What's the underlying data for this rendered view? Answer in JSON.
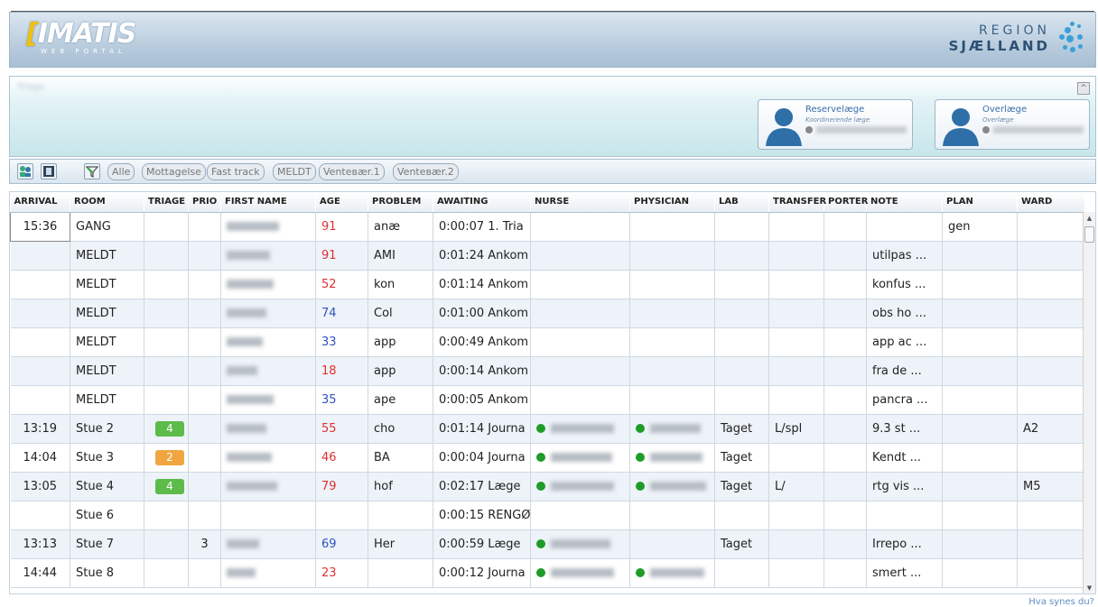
{
  "header": {
    "logo_main": "IMATIS",
    "logo_sub": "WEB PORTAL",
    "region_line1": "REGION",
    "region_line2": "SJÆLLAND"
  },
  "panel": {
    "title": "Triage",
    "cards": [
      {
        "role": "Reservelæge",
        "sub": "Koordinerende læge"
      },
      {
        "role": "Overlæge",
        "sub": "Overlæge"
      }
    ]
  },
  "toolbar": {
    "filters": [
      "Alle",
      "Mottagelse",
      "Fast track",
      "MELDT",
      "Venteвær.1",
      "Venteвær.2"
    ]
  },
  "table": {
    "columns": [
      "ARRIVAL",
      "ROOM",
      "TRIAGE",
      "PRIO",
      "FIRST NAME",
      "AGE",
      "PROBLEM",
      "AWAITING",
      "NURSE",
      "PHYSICIAN",
      "LAB",
      "TRANSFER",
      "PORTER",
      "NOTE",
      "PLAN",
      "WARD"
    ],
    "rows": [
      {
        "arrival": "15:36",
        "room": "GANG",
        "triage": "",
        "triage_color": "",
        "prio": "",
        "age": "91",
        "age_color": "red",
        "problem": "anæ",
        "awaiting": "0:00:07 1. Tria",
        "nurse": false,
        "physician": false,
        "lab": "",
        "transfer": "",
        "porter": "",
        "note": "",
        "plan": "gen",
        "ward": ""
      },
      {
        "arrival": "",
        "room": "MELDT",
        "triage": "",
        "triage_color": "",
        "prio": "",
        "age": "91",
        "age_color": "red",
        "problem": "AMI",
        "awaiting": "0:01:24 Ankom",
        "nurse": false,
        "physician": false,
        "lab": "",
        "transfer": "",
        "porter": "",
        "note": "utilpas ...",
        "plan": "",
        "ward": ""
      },
      {
        "arrival": "",
        "room": "MELDT",
        "triage": "",
        "triage_color": "",
        "prio": "",
        "age": "52",
        "age_color": "red",
        "problem": "kon",
        "awaiting": "0:01:14 Ankom",
        "nurse": false,
        "physician": false,
        "lab": "",
        "transfer": "",
        "porter": "",
        "note": "konfus ...",
        "plan": "",
        "ward": ""
      },
      {
        "arrival": "",
        "room": "MELDT",
        "triage": "",
        "triage_color": "",
        "prio": "",
        "age": "74",
        "age_color": "blue",
        "problem": "Col",
        "awaiting": "0:01:00 Ankom",
        "nurse": false,
        "physician": false,
        "lab": "",
        "transfer": "",
        "porter": "",
        "note": "obs ho ...",
        "plan": "",
        "ward": ""
      },
      {
        "arrival": "",
        "room": "MELDT",
        "triage": "",
        "triage_color": "",
        "prio": "",
        "age": "33",
        "age_color": "blue",
        "problem": "app",
        "awaiting": "0:00:49 Ankom",
        "nurse": false,
        "physician": false,
        "lab": "",
        "transfer": "",
        "porter": "",
        "note": "app ac ...",
        "plan": "",
        "ward": ""
      },
      {
        "arrival": "",
        "room": "MELDT",
        "triage": "",
        "triage_color": "",
        "prio": "",
        "age": "18",
        "age_color": "red",
        "problem": "app",
        "awaiting": "0:00:14 Ankom",
        "nurse": false,
        "physician": false,
        "lab": "",
        "transfer": "",
        "porter": "",
        "note": "fra de ...",
        "plan": "",
        "ward": ""
      },
      {
        "arrival": "",
        "room": "MELDT",
        "triage": "",
        "triage_color": "",
        "prio": "",
        "age": "35",
        "age_color": "blue",
        "problem": "ape",
        "awaiting": "0:00:05 Ankom",
        "nurse": false,
        "physician": false,
        "lab": "",
        "transfer": "",
        "porter": "",
        "note": "pancra ...",
        "plan": "",
        "ward": ""
      },
      {
        "arrival": "13:19",
        "room": "Stue 2",
        "triage": "4",
        "triage_color": "green",
        "prio": "",
        "age": "55",
        "age_color": "red",
        "problem": "cho",
        "awaiting": "0:01:14 Journa",
        "nurse": true,
        "physician": true,
        "lab": "Taget",
        "transfer": "L/spl",
        "porter": "",
        "note": "9.3 st ...",
        "plan": "",
        "ward": "A2"
      },
      {
        "arrival": "14:04",
        "room": "Stue 3",
        "triage": "2",
        "triage_color": "orange",
        "prio": "",
        "age": "46",
        "age_color": "red",
        "problem": "BA",
        "awaiting": "0:00:04 Journa",
        "nurse": true,
        "physician": true,
        "lab": "Taget",
        "transfer": "",
        "porter": "",
        "note": "Kendt ...",
        "plan": "",
        "ward": ""
      },
      {
        "arrival": "13:05",
        "room": "Stue 4",
        "triage": "4",
        "triage_color": "green",
        "prio": "",
        "age": "79",
        "age_color": "red",
        "problem": "hof",
        "awaiting": "0:02:17 Læge",
        "nurse": true,
        "physician": true,
        "lab": "Taget",
        "transfer": "L/",
        "porter": "",
        "note": "rtg vis ...",
        "plan": "",
        "ward": "M5"
      },
      {
        "arrival": "",
        "room": "Stue 6",
        "triage": "",
        "triage_color": "",
        "prio": "",
        "age": "",
        "age_color": "",
        "problem": "",
        "awaiting": "0:00:15 RENGØ",
        "nurse": false,
        "physician": false,
        "lab": "",
        "transfer": "",
        "porter": "",
        "note": "",
        "plan": "",
        "ward": ""
      },
      {
        "arrival": "13:13",
        "room": "Stue 7",
        "triage": "",
        "triage_color": "",
        "prio": "3",
        "age": "69",
        "age_color": "blue",
        "problem": "Her",
        "awaiting": "0:00:59 Læge",
        "nurse": true,
        "physician": false,
        "lab": "Taget",
        "transfer": "",
        "porter": "",
        "note": "Irrepo ...",
        "plan": "",
        "ward": ""
      },
      {
        "arrival": "14:44",
        "room": "Stue 8",
        "triage": "",
        "triage_color": "",
        "prio": "",
        "age": "23",
        "age_color": "red",
        "problem": "",
        "awaiting": "0:00:12 Journa",
        "nurse": true,
        "physician": true,
        "lab": "",
        "transfer": "",
        "porter": "",
        "note": "smert ...",
        "plan": "",
        "ward": ""
      }
    ]
  },
  "footer": {
    "help_link": "Hva synes du?"
  }
}
